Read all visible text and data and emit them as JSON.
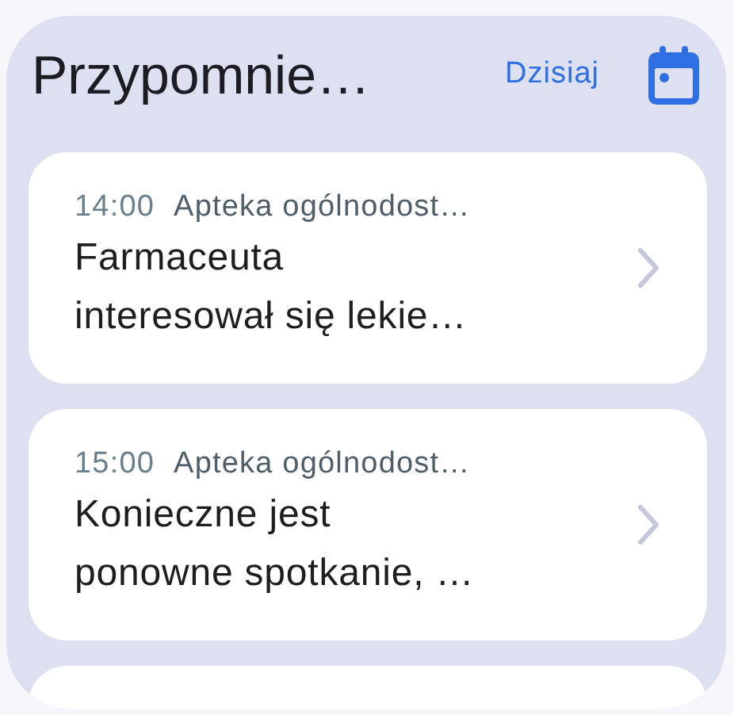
{
  "header": {
    "title": "Przypomnie…",
    "today_link": "Dzisiaj"
  },
  "reminders": [
    {
      "time": "14:00",
      "place": "Apteka ogólnodost…",
      "text": "Farmaceuta\ninteresował się lekie…"
    },
    {
      "time": "15:00",
      "place": "Apteka ogólnodost…",
      "text": "Konieczne jest\nponowne spotkanie, …"
    }
  ]
}
